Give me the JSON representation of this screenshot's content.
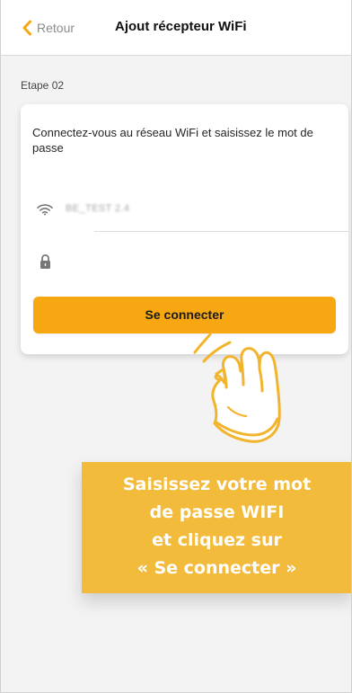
{
  "header": {
    "back_label": "Retour",
    "title": "Ajout récepteur WiFi",
    "back_icon": "chevron-left-icon",
    "accent_color": "#f6a712"
  },
  "step": {
    "label": "Etape 02"
  },
  "card": {
    "instruction": "Connectez-vous au réseau WiFi et saisissez le mot de passe",
    "wifi": {
      "icon": "wifi-icon",
      "value": "BE_TEST 2.4"
    },
    "password": {
      "icon": "lock-icon",
      "value": "",
      "placeholder": ""
    },
    "connect_button": {
      "label": "Se connecter",
      "color": "#f6a712"
    }
  },
  "illustration": {
    "icon": "pointing-hand-icon",
    "color": "#f2b42c"
  },
  "callout": {
    "lines": [
      "Saisissez votre mot",
      "de passe WIFI",
      "et cliquez sur",
      "« Se connecter »"
    ],
    "background_color": "#f3bb3b"
  }
}
